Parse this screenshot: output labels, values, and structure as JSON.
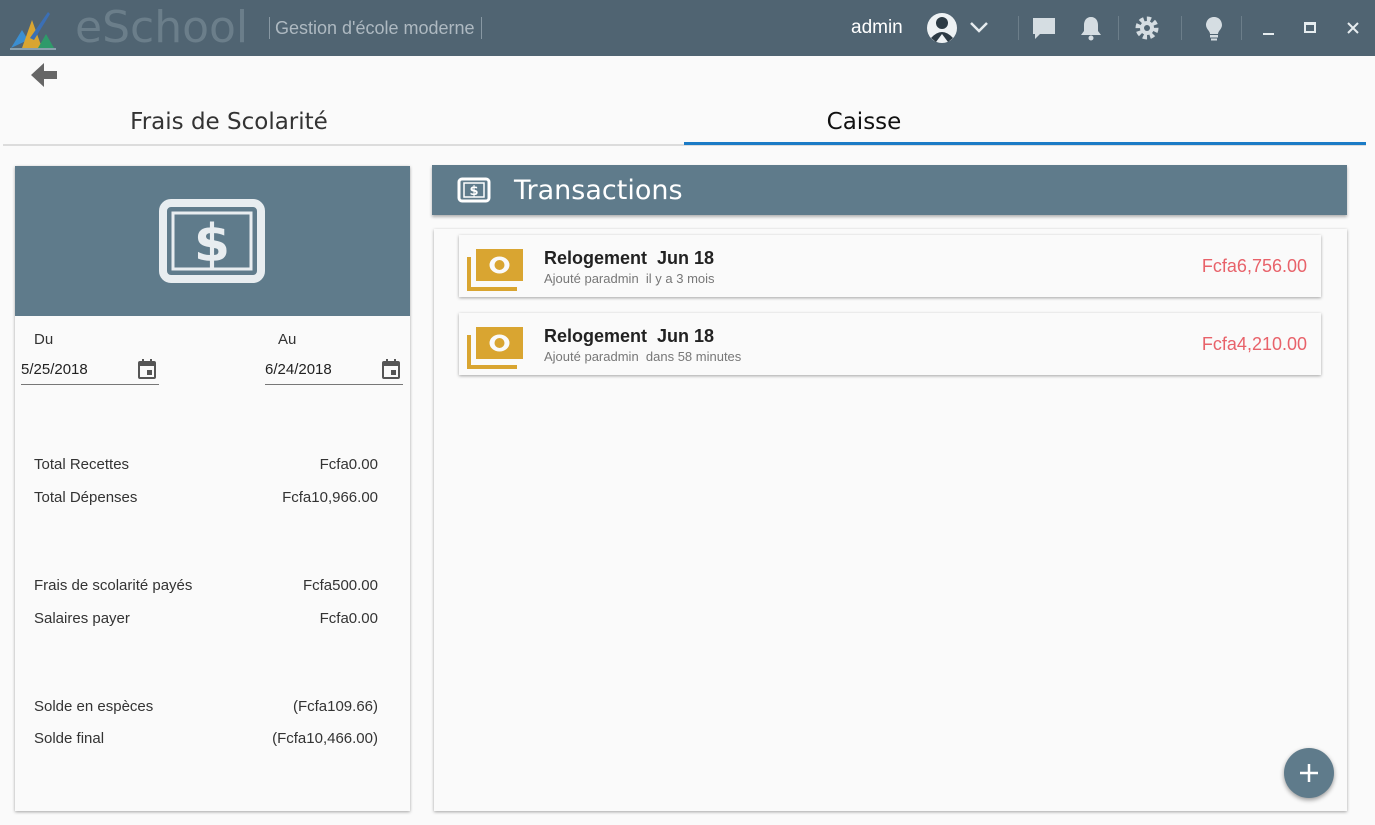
{
  "titlebar": {
    "app_name": "eSchool",
    "subtitle": "Gestion d'école moderne",
    "user": "admin"
  },
  "tabs": [
    {
      "label": "Frais de Scolarité"
    },
    {
      "label": "Caisse"
    }
  ],
  "filters": {
    "from_label": "Du",
    "from_value": "5/25/2018",
    "to_label": "Au",
    "to_value": "6/24/2018"
  },
  "summary": [
    {
      "label": "Total Recettes",
      "value": "Fcfa0.00"
    },
    {
      "label": "Total Dépenses",
      "value": "Fcfa10,966.00"
    },
    {
      "label": "Frais de scolarité payés",
      "value": "Fcfa500.00"
    },
    {
      "label": "Salaires payer",
      "value": "Fcfa0.00"
    },
    {
      "label": "Solde en espèces",
      "value": "(Fcfa109.66)"
    },
    {
      "label": "Solde final",
      "value": "(Fcfa10,466.00)"
    }
  ],
  "transactions": {
    "title": "Transactions",
    "items": [
      {
        "name": "Relogement  Jun 18",
        "meta": "Ajouté paradmin  il y a 3 mois",
        "amount": "Fcfa6,756.00"
      },
      {
        "name": "Relogement  Jun 18",
        "meta": "Ajouté paradmin  dans 58 minutes",
        "amount": "Fcfa4,210.00"
      }
    ]
  },
  "colors": {
    "titlebar": "#506472",
    "header": "#5f7b8b",
    "accent": "#1b7bc6",
    "amount": "#e8626a",
    "bill": "#d9a531"
  }
}
